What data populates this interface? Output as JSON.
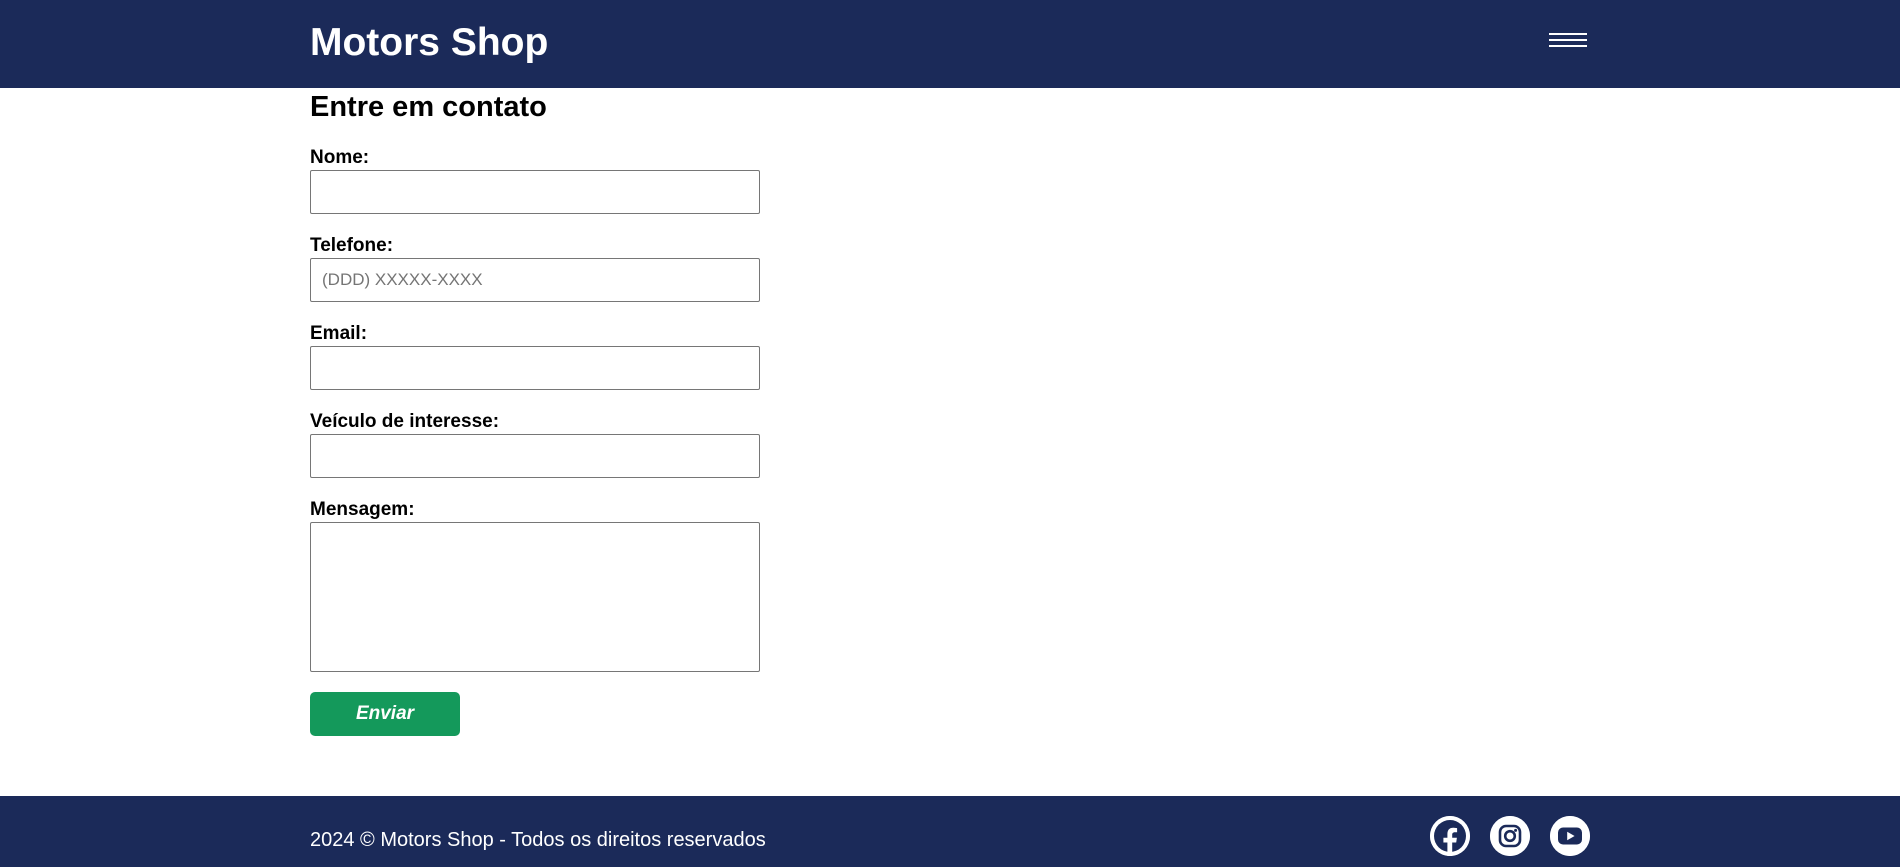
{
  "header": {
    "brand": "Motors Shop",
    "menu_icon": "hamburger-menu-icon"
  },
  "form": {
    "title": "Entre em contato",
    "name_label": "Nome:",
    "name_value": "",
    "phone_label": "Telefone:",
    "phone_placeholder": "(DDD) XXXXX-XXXX",
    "phone_value": "",
    "email_label": "Email:",
    "email_value": "",
    "vehicle_label": "Veículo de interesse:",
    "vehicle_value": "",
    "message_label": "Mensagem:",
    "message_value": "",
    "submit_label": "Enviar"
  },
  "footer": {
    "copyright": "2024 © Motors Shop - Todos os direitos reservados",
    "social_icons": [
      "facebook-icon",
      "instagram-icon",
      "youtube-icon"
    ]
  },
  "colors": {
    "header_bg": "#1b2a59",
    "footer_bg": "#1b2a59",
    "submit_bg": "#14995b",
    "text_on_dark": "#ffffff"
  }
}
